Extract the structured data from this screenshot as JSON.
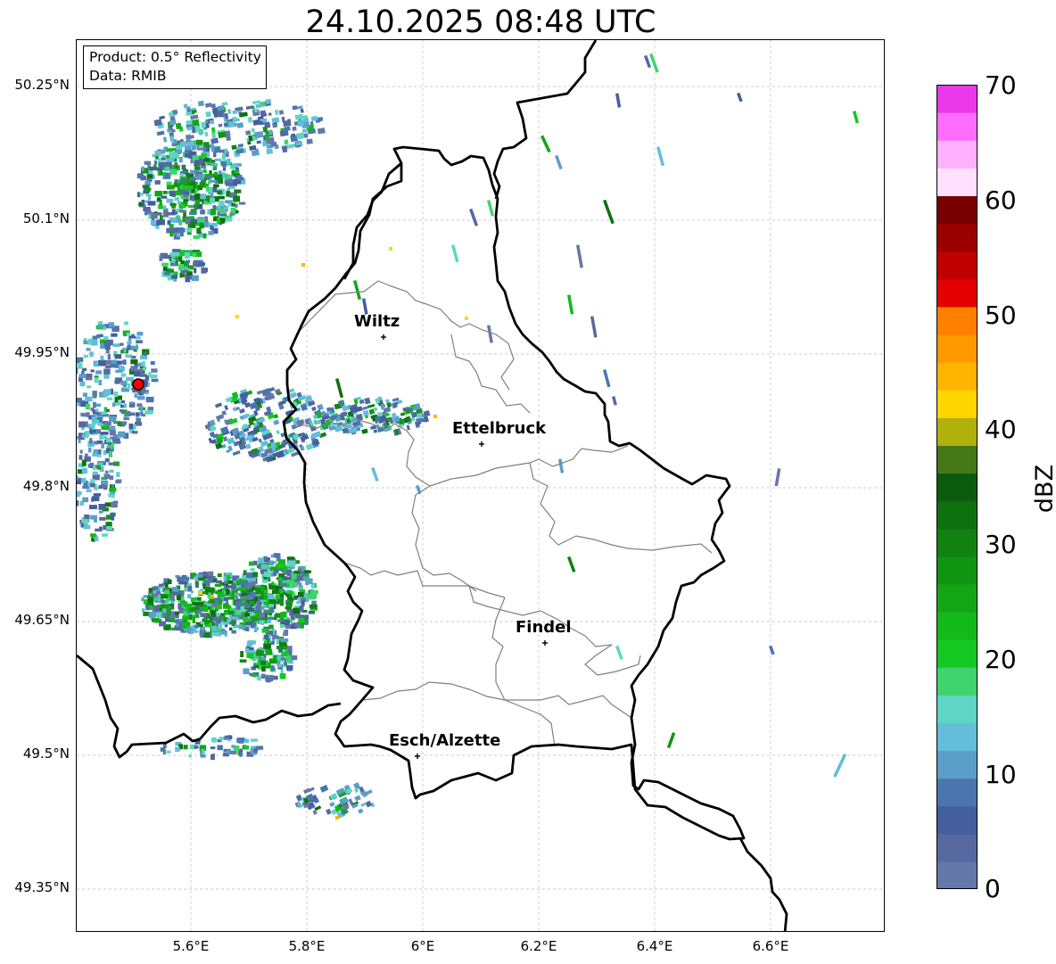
{
  "title": "24.10.2025 08:48 UTC",
  "info_box": {
    "product": "Product: 0.5° Reflectivity",
    "data_source": "Data: RMIB"
  },
  "map": {
    "lat_ticks": [
      "50.25°N",
      "50.1°N",
      "49.95°N",
      "49.8°N",
      "49.65°N",
      "49.5°N",
      "49.35°N"
    ],
    "lon_ticks": [
      "5.6°E",
      "5.8°E",
      "6°E",
      "6.2°E",
      "6.4°E",
      "6.6°E"
    ],
    "cities": [
      {
        "name": "Wiltz",
        "lon": 5.93,
        "lat": 49.966
      },
      {
        "name": "Ettelbruck",
        "lon": 6.1,
        "lat": 49.847
      },
      {
        "name": "Findel",
        "lon": 6.21,
        "lat": 49.627
      },
      {
        "name": "Esch/Alzette",
        "lon": 5.99,
        "lat": 49.5
      }
    ],
    "radar_site": {
      "lon": 5.505,
      "lat": 49.914,
      "color": "#ff0000"
    },
    "extent": {
      "lon": [
        5.4,
        6.8
      ],
      "lat": [
        49.3,
        50.3
      ]
    },
    "gridlines": true
  },
  "colorbar": {
    "label": "dBZ",
    "ticks": [
      "70",
      "60",
      "50",
      "40",
      "30",
      "20",
      "10",
      "0"
    ],
    "range": [
      0,
      70
    ],
    "colors_bottom_to_top": [
      "#6577a8",
      "#55689f",
      "#445e9e",
      "#4b76ad",
      "#5a9ec9",
      "#63bddb",
      "#5fd6c3",
      "#3fd46d",
      "#14c922",
      "#13b81a",
      "#12a616",
      "#119412",
      "#0f8210",
      "#0d700e",
      "#0a5c0c",
      "#46781a",
      "#b0b10c",
      "#ffd700",
      "#ffb400",
      "#ff9900",
      "#ff7f00",
      "#e40000",
      "#c00000",
      "#9a0000",
      "#780000",
      "#ffe0ff",
      "#ffb0ff",
      "#ff6cff",
      "#ea38ea"
    ]
  }
}
